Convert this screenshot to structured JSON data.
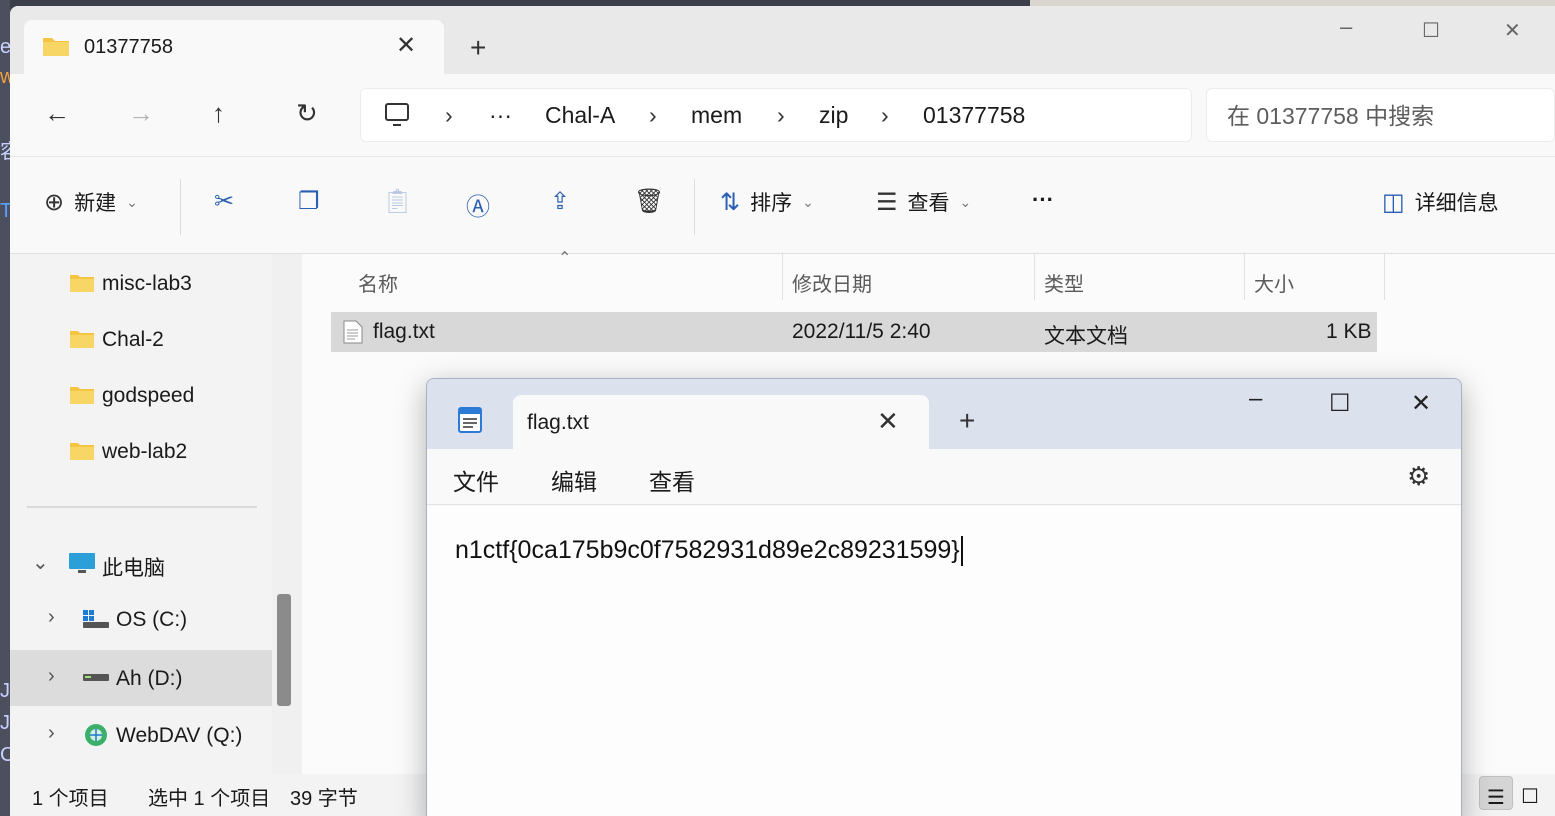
{
  "explorer": {
    "tab_title": "01377758",
    "breadcrumb": [
      "Chal-A",
      "mem",
      "zip",
      "01377758"
    ],
    "breadcrumb_overflow": "···",
    "search_placeholder": "在 01377758 中搜索",
    "toolbar": {
      "new_label": "新建",
      "sort_label": "排序",
      "view_label": "查看",
      "more_label": "···",
      "details_label": "详细信息"
    },
    "sidebar": {
      "folders": [
        "misc-lab3",
        "Chal-2",
        "godspeed",
        "web-lab2"
      ],
      "this_pc": "此电脑",
      "drives": [
        {
          "label": "OS (C:)",
          "icon": "windows-drive-icon"
        },
        {
          "label": "Ah (D:)",
          "icon": "drive-icon"
        },
        {
          "label": "WebDAV (Q:)",
          "icon": "network-drive-icon"
        }
      ]
    },
    "columns": [
      "名称",
      "修改日期",
      "类型",
      "大小"
    ],
    "files": [
      {
        "name": "flag.txt",
        "modified": "2022/11/5 2:40",
        "type": "文本文档",
        "size": "1 KB"
      }
    ],
    "status": {
      "count": "1 个项目",
      "selection": "选中 1 个项目",
      "bytes": "39 字节"
    }
  },
  "notepad": {
    "tab_title": "flag.txt",
    "menu": [
      "文件",
      "编辑",
      "查看"
    ],
    "content": "n1ctf{0ca175b9c0f7582931d89e2c89231599}"
  },
  "colors": {
    "accent": "#2b5fb3",
    "folder": "#f4c542",
    "notepad_titlebar": "#dce1ee"
  }
}
